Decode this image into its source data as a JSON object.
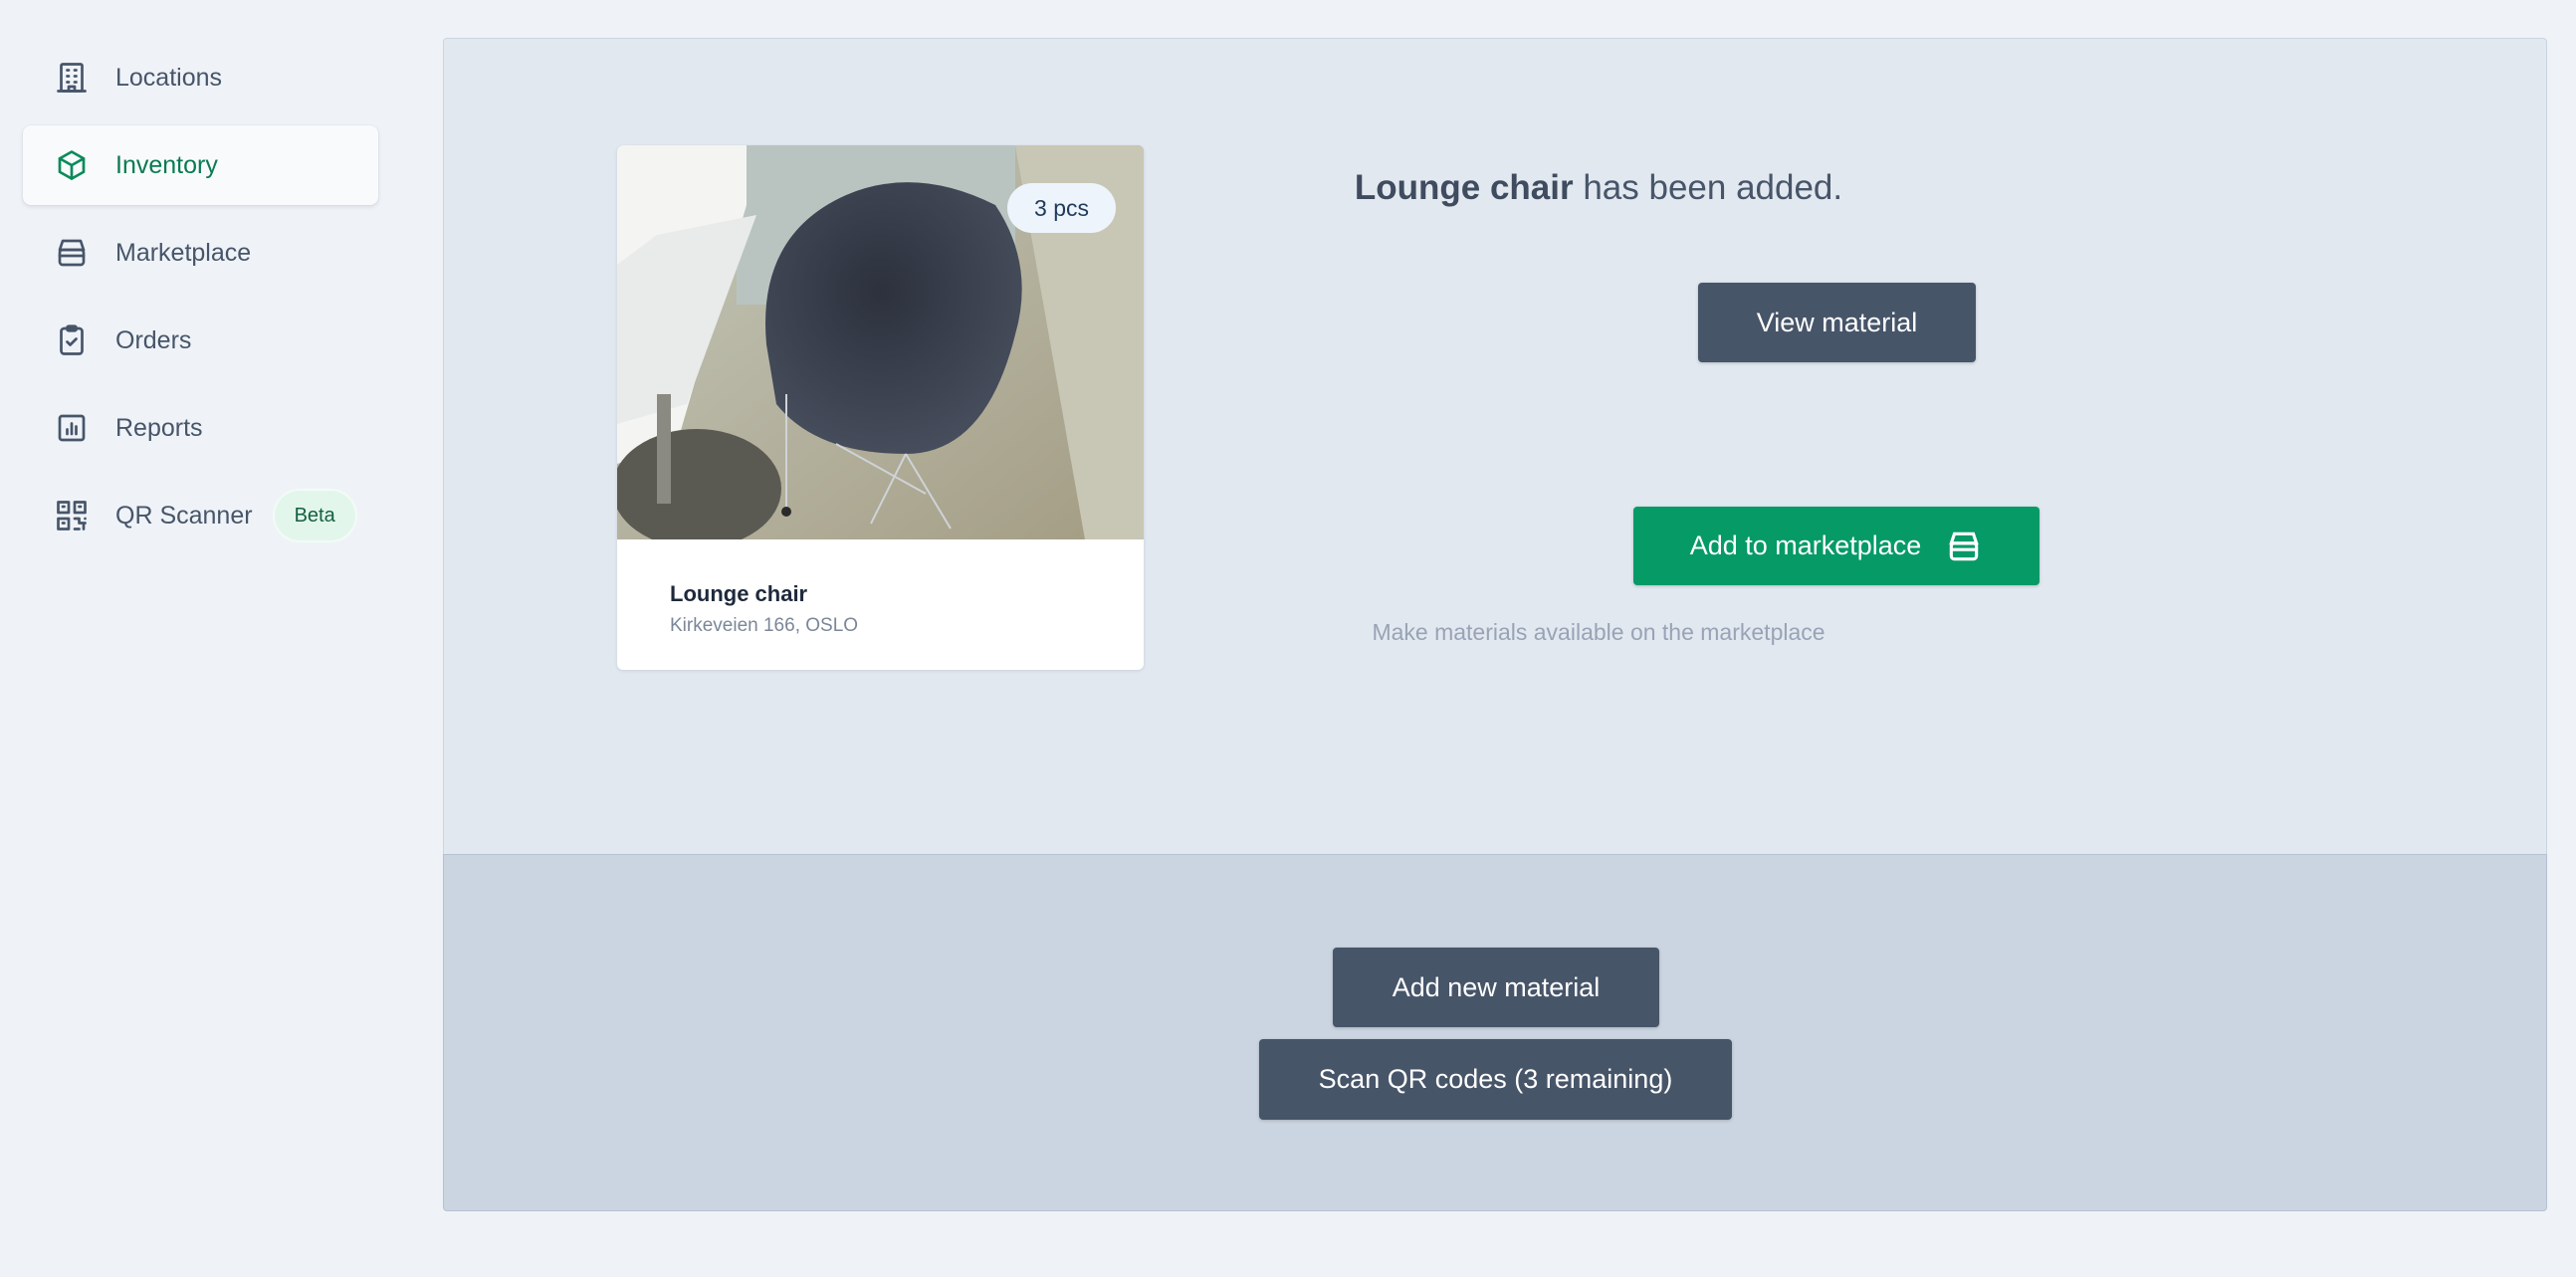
{
  "sidebar": {
    "items": [
      {
        "label": "Locations",
        "icon": "building-icon"
      },
      {
        "label": "Inventory",
        "icon": "cube-icon",
        "active": true
      },
      {
        "label": "Marketplace",
        "icon": "storefront-icon"
      },
      {
        "label": "Orders",
        "icon": "clipboard-check-icon"
      },
      {
        "label": "Reports",
        "icon": "bar-chart-icon"
      },
      {
        "label": "QR Scanner",
        "icon": "qr-code-icon",
        "badge": "Beta"
      }
    ]
  },
  "card": {
    "quantity": "3 pcs",
    "title": "Lounge chair",
    "location": "Kirkeveien 166, OSLO"
  },
  "confirmation": {
    "item_name": "Lounge chair",
    "message": " has been added."
  },
  "actions": {
    "view_material": "View material",
    "add_to_marketplace": "Add to marketplace",
    "marketplace_hint": "Make materials available on the marketplace",
    "add_new_material": "Add new material",
    "scan_qr_codes": "Scan QR codes (3 remaining)"
  },
  "colors": {
    "accent_green": "#069a67",
    "active_nav_text": "#0b7a51",
    "dark_button": "#475569"
  }
}
